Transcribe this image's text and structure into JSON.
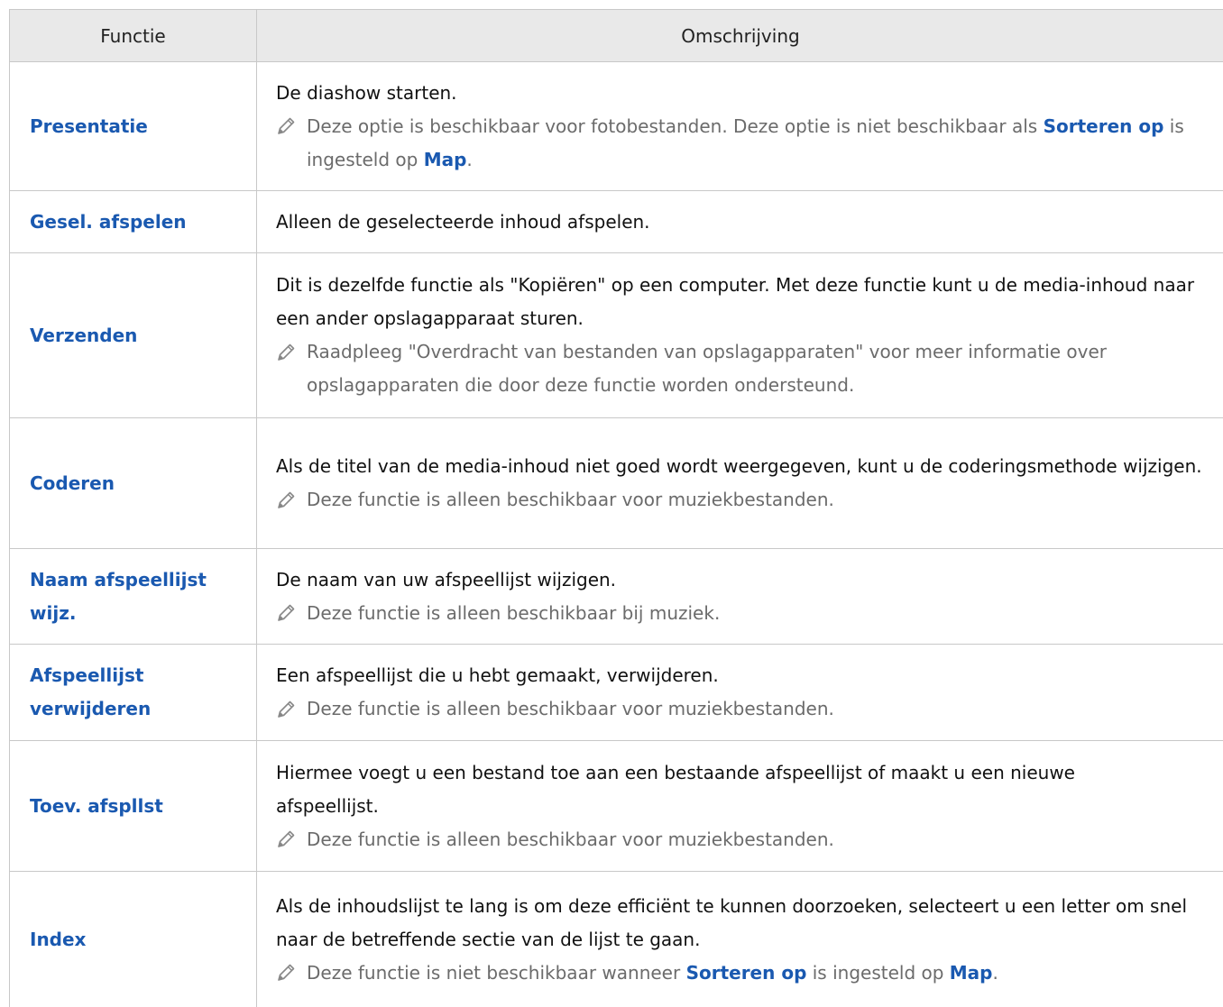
{
  "header": {
    "col_function": "Functie",
    "col_description": "Omschrijving"
  },
  "rows": [
    {
      "function": "Presentatie",
      "description": "De diashow starten.",
      "note": {
        "part1": "Deze optie is beschikbaar voor fotobestanden. Deze optie is niet beschikbaar als ",
        "hl1": "Sorteren op",
        "part2": " is ingesteld op ",
        "hl2": "Map",
        "part3": "."
      }
    },
    {
      "function": "Gesel. afspelen",
      "description": "Alleen de geselecteerde inhoud afspelen."
    },
    {
      "function": "Verzenden",
      "description": "Dit is dezelfde functie als \"Kopiëren\" op een computer. Met deze functie kunt u de media-inhoud naar een ander opslagapparaat sturen.",
      "note": "Raadpleeg \"Overdracht van bestanden van opslagapparaten\" voor meer informatie over opslagapparaten die door deze functie worden ondersteund."
    },
    {
      "function": "Coderen",
      "description": "Als de titel van de media-inhoud niet goed wordt weergegeven, kunt u de coderingsmethode wijzigen.",
      "note": "Deze functie is alleen beschikbaar voor muziekbestanden."
    },
    {
      "function": "Naam afspeellijst wijz.",
      "description": "De naam van uw afspeellijst wijzigen.",
      "note": "Deze functie is alleen beschikbaar bij muziek."
    },
    {
      "function": "Afspeellijst verwijderen",
      "description": "Een afspeellijst die u hebt gemaakt, verwijderen.",
      "note": "Deze functie is alleen beschikbaar voor muziekbestanden."
    },
    {
      "function": "Toev. afspllst",
      "description": "Hiermee voegt u een bestand toe aan een bestaande afspeellijst of maakt u een nieuwe afspeellijst.",
      "note": "Deze functie is alleen beschikbaar voor muziekbestanden."
    },
    {
      "function": "Index",
      "description": "Als de inhoudslijst te lang is om deze efficiënt te kunnen doorzoeken, selecteert u een letter om snel naar de betreffende sectie van de lijst te gaan.",
      "note": {
        "part1": "Deze functie is niet beschikbaar wanneer ",
        "hl1": "Sorteren op",
        "part2": " is ingesteld op ",
        "hl2": "Map",
        "part3": "."
      }
    }
  ],
  "icons": {
    "note": "pencil-icon"
  },
  "colors": {
    "function_link": "#1a59b0",
    "header_bg": "#e9e9e9",
    "note_text": "#6b6b6b",
    "border": "#c8c8c8"
  }
}
